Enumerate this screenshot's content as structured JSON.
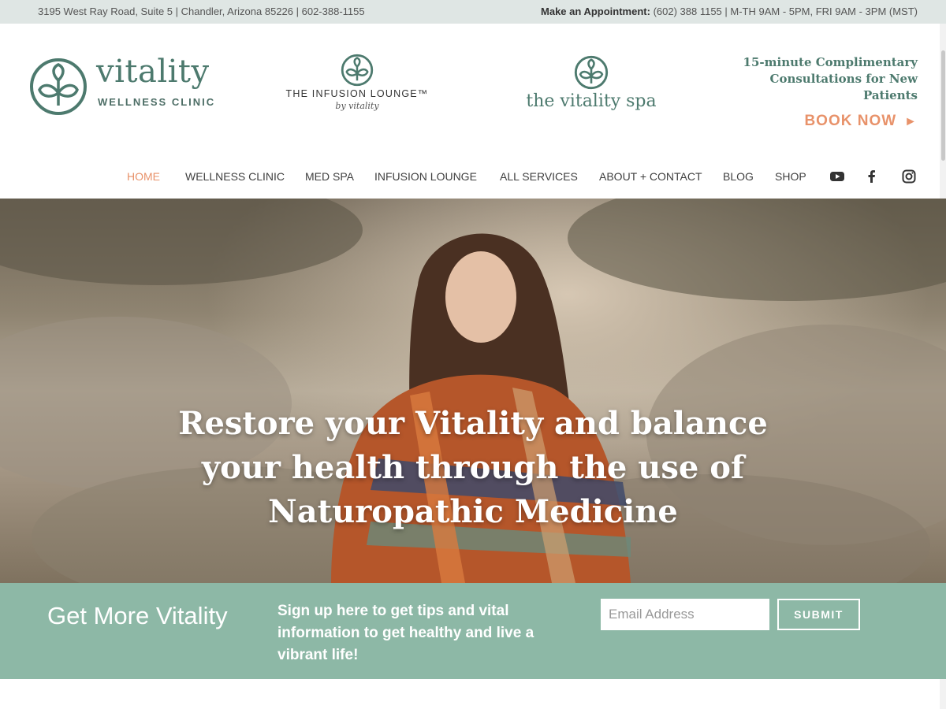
{
  "topbar": {
    "address": "3195 West Ray Road, Suite 5 | Chandler, Arizona 85226 | 602-388-1155",
    "appointment_label": "Make an Appointment:",
    "appointment_info": "(602) 388 1155 | M-TH 9AM - 5PM, FRI 9AM - 3PM (MST)"
  },
  "logos": {
    "clinic_word": "vitality",
    "clinic_sub": "WELLNESS CLINIC",
    "infusion_name": "THE INFUSION LOUNGE™",
    "infusion_by": "by vitality",
    "spa_name": "the vitality spa"
  },
  "header": {
    "consult_text": "15-minute Complimentary Consultations for New Patients",
    "book_now": "BOOK NOW",
    "book_arrow": "►"
  },
  "nav": {
    "items": [
      "HOME",
      "WELLNESS CLINIC",
      "MED SPA",
      "INFUSION LOUNGE",
      "ALL SERVICES",
      "ABOUT + CONTACT",
      "BLOG",
      "SHOP"
    ],
    "active": "HOME",
    "social": [
      "youtube-icon",
      "facebook-icon",
      "instagram-icon"
    ]
  },
  "hero": {
    "headline": "Restore your Vitality and balance your health through the use of Naturopathic Medicine"
  },
  "signup": {
    "title": "Get More Vitality",
    "description": "Sign up here to get tips and vital information to get healthy and live a vibrant life!",
    "email_placeholder": "Email Address",
    "submit_label": "SUBMIT"
  },
  "colors": {
    "accent": "#e8926a",
    "brand_green": "#4d7a6e",
    "band_green": "#8db8a6",
    "topbar_bg": "#dfe6e4"
  }
}
